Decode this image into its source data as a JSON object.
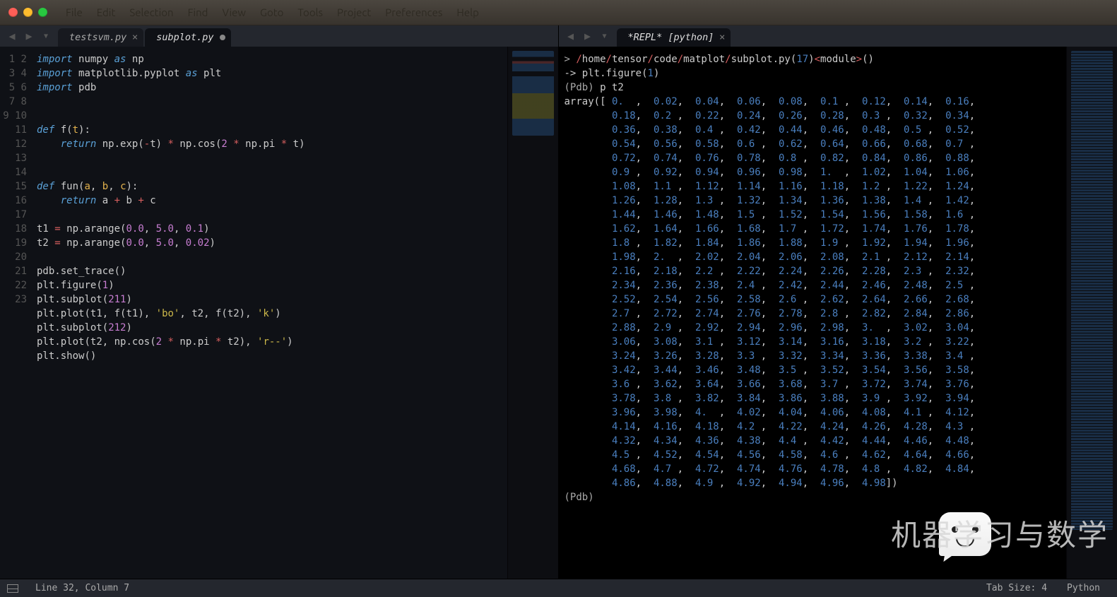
{
  "menus": [
    "File",
    "Edit",
    "Selection",
    "Find",
    "View",
    "Goto",
    "Tools",
    "Project",
    "Preferences",
    "Help"
  ],
  "pane_left": {
    "tabs": [
      {
        "label": "testsvm.py",
        "active": false,
        "dirty": false
      },
      {
        "label": "subplot.py",
        "active": true,
        "dirty": true
      }
    ],
    "lines": 23
  },
  "code": {
    "l1": [
      [
        "kw",
        "import"
      ],
      [
        "sp",
        " "
      ],
      [
        "id",
        "numpy"
      ],
      [
        "sp",
        " "
      ],
      [
        "kw",
        "as"
      ],
      [
        "sp",
        " "
      ],
      [
        "id",
        "np"
      ]
    ],
    "l2": [
      [
        "kw",
        "import"
      ],
      [
        "sp",
        " "
      ],
      [
        "id",
        "matplotlib.pyplot"
      ],
      [
        "sp",
        " "
      ],
      [
        "kw",
        "as"
      ],
      [
        "sp",
        " "
      ],
      [
        "id",
        "plt"
      ]
    ],
    "l3": [
      [
        "kw",
        "import"
      ],
      [
        "sp",
        " "
      ],
      [
        "id",
        "pdb"
      ]
    ],
    "l4": [],
    "l5": [],
    "l6": [
      [
        "kw",
        "def"
      ],
      [
        "sp",
        " "
      ],
      [
        "fn",
        "f"
      ],
      [
        "pn",
        "("
      ],
      [
        "pr",
        "t"
      ],
      [
        "pn",
        "):"
      ]
    ],
    "l7": [
      [
        "sp",
        "    "
      ],
      [
        "kw",
        "return"
      ],
      [
        "sp",
        " "
      ],
      [
        "id",
        "np"
      ],
      [
        "pn",
        "."
      ],
      [
        "id",
        "exp"
      ],
      [
        "pn",
        "("
      ],
      [
        "op",
        "-"
      ],
      [
        "id",
        "t"
      ],
      [
        "pn",
        ")"
      ],
      [
        "sp",
        " "
      ],
      [
        "op",
        "*"
      ],
      [
        "sp",
        " "
      ],
      [
        "id",
        "np"
      ],
      [
        "pn",
        "."
      ],
      [
        "id",
        "cos"
      ],
      [
        "pn",
        "("
      ],
      [
        "nm",
        "2"
      ],
      [
        "sp",
        " "
      ],
      [
        "op",
        "*"
      ],
      [
        "sp",
        " "
      ],
      [
        "id",
        "np"
      ],
      [
        "pn",
        "."
      ],
      [
        "id",
        "pi"
      ],
      [
        "sp",
        " "
      ],
      [
        "op",
        "*"
      ],
      [
        "sp",
        " "
      ],
      [
        "id",
        "t"
      ],
      [
        "pn",
        ")"
      ]
    ],
    "l8": [],
    "l9": [],
    "l10": [
      [
        "kw",
        "def"
      ],
      [
        "sp",
        " "
      ],
      [
        "fn",
        "fun"
      ],
      [
        "pn",
        "("
      ],
      [
        "pr",
        "a"
      ],
      [
        "pn",
        ", "
      ],
      [
        "pr",
        "b"
      ],
      [
        "pn",
        ", "
      ],
      [
        "pr",
        "c"
      ],
      [
        "pn",
        "):"
      ]
    ],
    "l11": [
      [
        "sp",
        "    "
      ],
      [
        "kw",
        "return"
      ],
      [
        "sp",
        " "
      ],
      [
        "id",
        "a"
      ],
      [
        "sp",
        " "
      ],
      [
        "op",
        "+"
      ],
      [
        "sp",
        " "
      ],
      [
        "id",
        "b"
      ],
      [
        "sp",
        " "
      ],
      [
        "op",
        "+"
      ],
      [
        "sp",
        " "
      ],
      [
        "id",
        "c"
      ]
    ],
    "l12": [],
    "l13": [
      [
        "id",
        "t1"
      ],
      [
        "sp",
        " "
      ],
      [
        "op",
        "="
      ],
      [
        "sp",
        " "
      ],
      [
        "id",
        "np"
      ],
      [
        "pn",
        "."
      ],
      [
        "id",
        "arange"
      ],
      [
        "pn",
        "("
      ],
      [
        "nm",
        "0.0"
      ],
      [
        "pn",
        ", "
      ],
      [
        "nm",
        "5.0"
      ],
      [
        "pn",
        ", "
      ],
      [
        "nm",
        "0.1"
      ],
      [
        "pn",
        ")"
      ]
    ],
    "l14": [
      [
        "id",
        "t2"
      ],
      [
        "sp",
        " "
      ],
      [
        "op",
        "="
      ],
      [
        "sp",
        " "
      ],
      [
        "id",
        "np"
      ],
      [
        "pn",
        "."
      ],
      [
        "id",
        "arange"
      ],
      [
        "pn",
        "("
      ],
      [
        "nm",
        "0.0"
      ],
      [
        "pn",
        ", "
      ],
      [
        "nm",
        "5.0"
      ],
      [
        "pn",
        ", "
      ],
      [
        "nm",
        "0.02"
      ],
      [
        "pn",
        ")"
      ]
    ],
    "l15": [],
    "l16": [
      [
        "id",
        "pdb"
      ],
      [
        "pn",
        "."
      ],
      [
        "id",
        "set_trace"
      ],
      [
        "pn",
        "()"
      ]
    ],
    "l17": [
      [
        "id",
        "plt"
      ],
      [
        "pn",
        "."
      ],
      [
        "id",
        "figure"
      ],
      [
        "pn",
        "("
      ],
      [
        "nm",
        "1"
      ],
      [
        "pn",
        ")"
      ]
    ],
    "l18": [
      [
        "id",
        "plt"
      ],
      [
        "pn",
        "."
      ],
      [
        "id",
        "subplot"
      ],
      [
        "pn",
        "("
      ],
      [
        "nm",
        "211"
      ],
      [
        "pn",
        ")"
      ]
    ],
    "l19": [
      [
        "id",
        "plt"
      ],
      [
        "pn",
        "."
      ],
      [
        "id",
        "plot"
      ],
      [
        "pn",
        "("
      ],
      [
        "id",
        "t1"
      ],
      [
        "pn",
        ", "
      ],
      [
        "id",
        "f"
      ],
      [
        "pn",
        "("
      ],
      [
        "id",
        "t1"
      ],
      [
        "pn",
        "), "
      ],
      [
        "st",
        "'bo'"
      ],
      [
        "pn",
        ", "
      ],
      [
        "id",
        "t2"
      ],
      [
        "pn",
        ", "
      ],
      [
        "id",
        "f"
      ],
      [
        "pn",
        "("
      ],
      [
        "id",
        "t2"
      ],
      [
        "pn",
        "), "
      ],
      [
        "st",
        "'k'"
      ],
      [
        "pn",
        ")"
      ]
    ],
    "l20": [
      [
        "id",
        "plt"
      ],
      [
        "pn",
        "."
      ],
      [
        "id",
        "subplot"
      ],
      [
        "pn",
        "("
      ],
      [
        "nm",
        "212"
      ],
      [
        "pn",
        ")"
      ]
    ],
    "l21": [
      [
        "id",
        "plt"
      ],
      [
        "pn",
        "."
      ],
      [
        "id",
        "plot"
      ],
      [
        "pn",
        "("
      ],
      [
        "id",
        "t2"
      ],
      [
        "pn",
        ", "
      ],
      [
        "id",
        "np"
      ],
      [
        "pn",
        "."
      ],
      [
        "id",
        "cos"
      ],
      [
        "pn",
        "("
      ],
      [
        "nm",
        "2"
      ],
      [
        "sp",
        " "
      ],
      [
        "op",
        "*"
      ],
      [
        "sp",
        " "
      ],
      [
        "id",
        "np"
      ],
      [
        "pn",
        "."
      ],
      [
        "id",
        "pi"
      ],
      [
        "sp",
        " "
      ],
      [
        "op",
        "*"
      ],
      [
        "sp",
        " "
      ],
      [
        "id",
        "t2"
      ],
      [
        "pn",
        "), "
      ],
      [
        "st",
        "'r--'"
      ],
      [
        "pn",
        ")"
      ]
    ],
    "l22": [
      [
        "id",
        "plt"
      ],
      [
        "pn",
        "."
      ],
      [
        "id",
        "show"
      ],
      [
        "pn",
        "()"
      ]
    ],
    "l23": []
  },
  "pane_right": {
    "tab": "*REPL* [python]",
    "path_parts": [
      "home",
      "tensor",
      "code",
      "matplot",
      "subplot.py"
    ],
    "path_line_no": "17",
    "path_module": "module",
    "arrow_line": "-> plt.figure(1)",
    "arrow_num": "1",
    "pdb1": "(Pdb) ",
    "pdb_cmd": "p t2",
    "array_head": "array([ ",
    "pdb2": "(Pdb) ",
    "values_per_row": 9,
    "values": [
      "0.",
      "0.02",
      "0.04",
      "0.06",
      "0.08",
      "0.1",
      "0.12",
      "0.14",
      "0.16",
      "0.18",
      "0.2",
      "0.22",
      "0.24",
      "0.26",
      "0.28",
      "0.3",
      "0.32",
      "0.34",
      "0.36",
      "0.38",
      "0.4",
      "0.42",
      "0.44",
      "0.46",
      "0.48",
      "0.5",
      "0.52",
      "0.54",
      "0.56",
      "0.58",
      "0.6",
      "0.62",
      "0.64",
      "0.66",
      "0.68",
      "0.7",
      "0.72",
      "0.74",
      "0.76",
      "0.78",
      "0.8",
      "0.82",
      "0.84",
      "0.86",
      "0.88",
      "0.9",
      "0.92",
      "0.94",
      "0.96",
      "0.98",
      "1.",
      "1.02",
      "1.04",
      "1.06",
      "1.08",
      "1.1",
      "1.12",
      "1.14",
      "1.16",
      "1.18",
      "1.2",
      "1.22",
      "1.24",
      "1.26",
      "1.28",
      "1.3",
      "1.32",
      "1.34",
      "1.36",
      "1.38",
      "1.4",
      "1.42",
      "1.44",
      "1.46",
      "1.48",
      "1.5",
      "1.52",
      "1.54",
      "1.56",
      "1.58",
      "1.6",
      "1.62",
      "1.64",
      "1.66",
      "1.68",
      "1.7",
      "1.72",
      "1.74",
      "1.76",
      "1.78",
      "1.8",
      "1.82",
      "1.84",
      "1.86",
      "1.88",
      "1.9",
      "1.92",
      "1.94",
      "1.96",
      "1.98",
      "2.",
      "2.02",
      "2.04",
      "2.06",
      "2.08",
      "2.1",
      "2.12",
      "2.14",
      "2.16",
      "2.18",
      "2.2",
      "2.22",
      "2.24",
      "2.26",
      "2.28",
      "2.3",
      "2.32",
      "2.34",
      "2.36",
      "2.38",
      "2.4",
      "2.42",
      "2.44",
      "2.46",
      "2.48",
      "2.5",
      "2.52",
      "2.54",
      "2.56",
      "2.58",
      "2.6",
      "2.62",
      "2.64",
      "2.66",
      "2.68",
      "2.7",
      "2.72",
      "2.74",
      "2.76",
      "2.78",
      "2.8",
      "2.82",
      "2.84",
      "2.86",
      "2.88",
      "2.9",
      "2.92",
      "2.94",
      "2.96",
      "2.98",
      "3.",
      "3.02",
      "3.04",
      "3.06",
      "3.08",
      "3.1",
      "3.12",
      "3.14",
      "3.16",
      "3.18",
      "3.2",
      "3.22",
      "3.24",
      "3.26",
      "3.28",
      "3.3",
      "3.32",
      "3.34",
      "3.36",
      "3.38",
      "3.4",
      "3.42",
      "3.44",
      "3.46",
      "3.48",
      "3.5",
      "3.52",
      "3.54",
      "3.56",
      "3.58",
      "3.6",
      "3.62",
      "3.64",
      "3.66",
      "3.68",
      "3.7",
      "3.72",
      "3.74",
      "3.76",
      "3.78",
      "3.8",
      "3.82",
      "3.84",
      "3.86",
      "3.88",
      "3.9",
      "3.92",
      "3.94",
      "3.96",
      "3.98",
      "4.",
      "4.02",
      "4.04",
      "4.06",
      "4.08",
      "4.1",
      "4.12",
      "4.14",
      "4.16",
      "4.18",
      "4.2",
      "4.22",
      "4.24",
      "4.26",
      "4.28",
      "4.3",
      "4.32",
      "4.34",
      "4.36",
      "4.38",
      "4.4",
      "4.42",
      "4.44",
      "4.46",
      "4.48",
      "4.5",
      "4.52",
      "4.54",
      "4.56",
      "4.58",
      "4.6",
      "4.62",
      "4.64",
      "4.66",
      "4.68",
      "4.7",
      "4.72",
      "4.74",
      "4.76",
      "4.78",
      "4.8",
      "4.82",
      "4.84",
      "4.86",
      "4.88",
      "4.9",
      "4.92",
      "4.94",
      "4.96",
      "4.98"
    ]
  },
  "status": {
    "pos": "Line 32, Column 7",
    "tab": "Tab Size: 4",
    "lang": "Python"
  },
  "watermark": "机器学习与数学"
}
